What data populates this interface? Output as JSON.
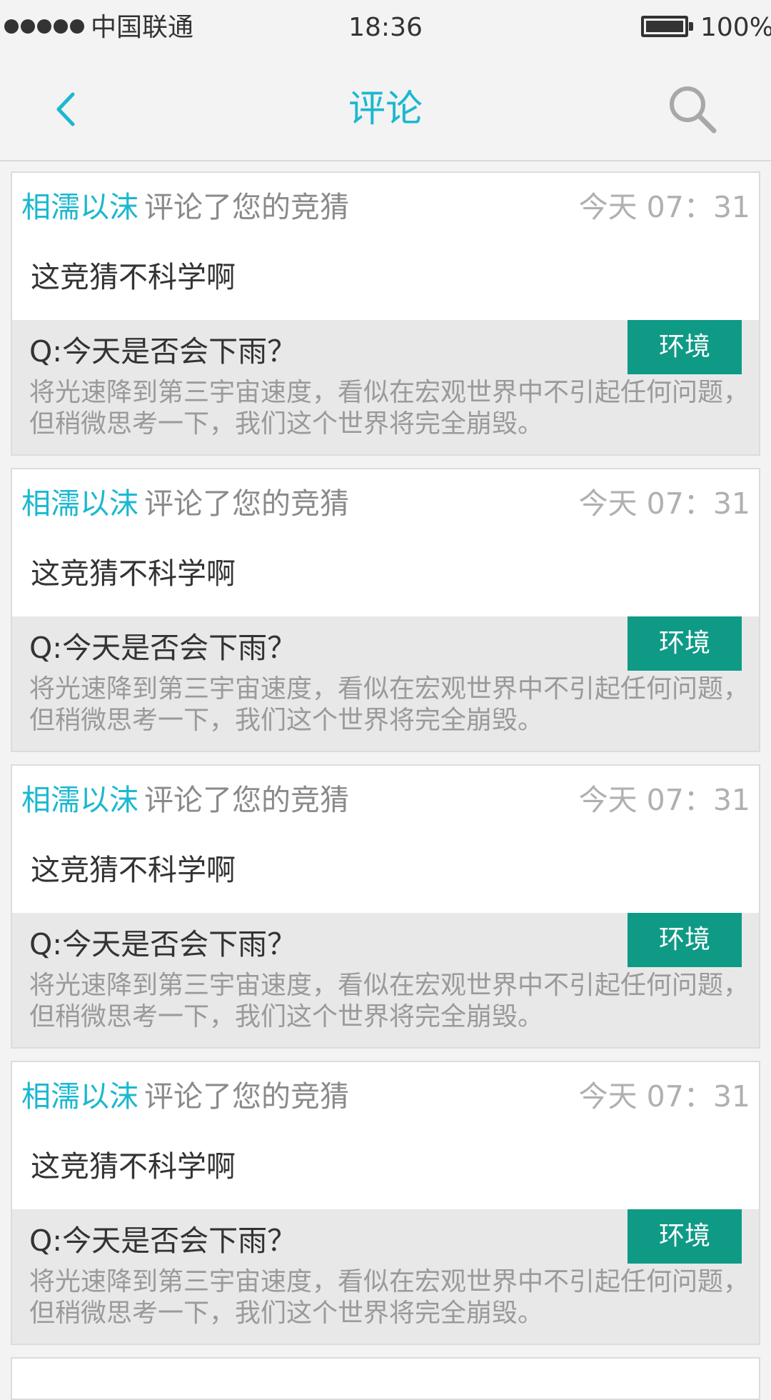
{
  "status_bar": {
    "carrier": "中国联通",
    "time": "18:36",
    "battery": "100%"
  },
  "nav": {
    "title": "评论",
    "back_icon": "chevron-left-icon",
    "search_icon": "search-icon"
  },
  "colors": {
    "accent": "#1bb8d0",
    "tag": "#0f9a86",
    "quote_bg": "#e8e8e8"
  },
  "comments": [
    {
      "user": "相濡以沫",
      "action": "评论了您的竞猜",
      "time": "今天 07：31",
      "comment": "这竞猜不科学啊",
      "question": "Q:今天是否会下雨？",
      "tag": "环境",
      "desc_line1": "将光速降到第三宇宙速度，看似在宏观世界中不引起任何问题，",
      "desc_line2": "但稍微思考一下，我们这个世界将完全崩毁。"
    },
    {
      "user": "相濡以沫",
      "action": "评论了您的竞猜",
      "time": "今天 07：31",
      "comment": "这竞猜不科学啊",
      "question": "Q:今天是否会下雨？",
      "tag": "环境",
      "desc_line1": "将光速降到第三宇宙速度，看似在宏观世界中不引起任何问题，",
      "desc_line2": "但稍微思考一下，我们这个世界将完全崩毁。"
    },
    {
      "user": "相濡以沫",
      "action": "评论了您的竞猜",
      "time": "今天 07：31",
      "comment": "这竞猜不科学啊",
      "question": "Q:今天是否会下雨？",
      "tag": "环境",
      "desc_line1": "将光速降到第三宇宙速度，看似在宏观世界中不引起任何问题，",
      "desc_line2": "但稍微思考一下，我们这个世界将完全崩毁。"
    },
    {
      "user": "相濡以沫",
      "action": "评论了您的竞猜",
      "time": "今天 07：31",
      "comment": "这竞猜不科学啊",
      "question": "Q:今天是否会下雨？",
      "tag": "环境",
      "desc_line1": "将光速降到第三宇宙速度，看似在宏观世界中不引起任何问题，",
      "desc_line2": "但稍微思考一下，我们这个世界将完全崩毁。"
    }
  ]
}
